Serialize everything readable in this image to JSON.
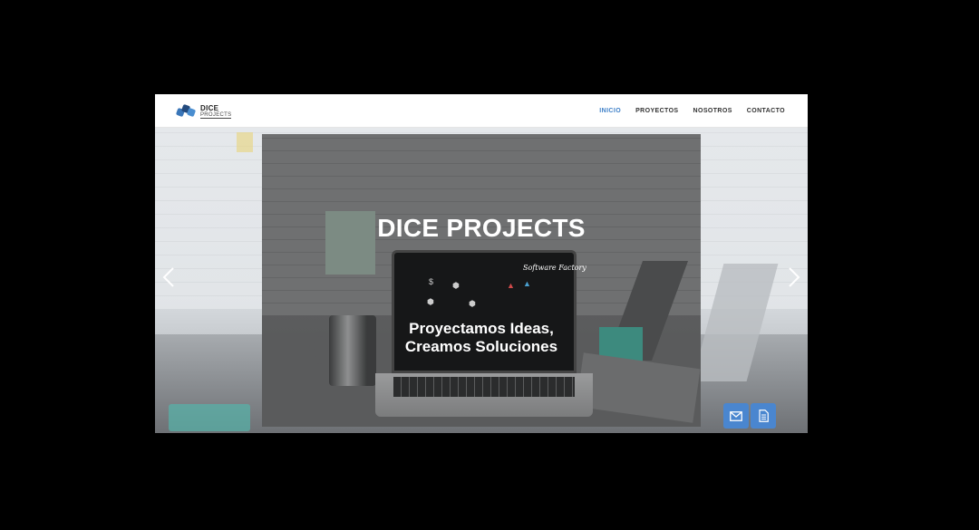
{
  "navbar": {
    "logo": {
      "line1": "DICE",
      "line2": "PROJECTS"
    },
    "links": [
      {
        "label": "INICIO",
        "active": true
      },
      {
        "label": "PROYECTOS",
        "active": false
      },
      {
        "label": "NOSOTROS",
        "active": false
      },
      {
        "label": "CONTACTO",
        "active": false
      }
    ]
  },
  "hero": {
    "title": "DICE PROJECTS",
    "script_tag": "Software Factory",
    "subtitle_line1": "Proyectamos Ideas,",
    "subtitle_line2": "Creamos Soluciones",
    "prev_icon": "chevron-left-icon",
    "next_icon": "chevron-right-icon"
  },
  "floating_buttons": [
    {
      "icon": "mail-icon"
    },
    {
      "icon": "document-icon"
    }
  ],
  "colors": {
    "accent": "#3d7fc8",
    "fab": "#4a86cf"
  }
}
